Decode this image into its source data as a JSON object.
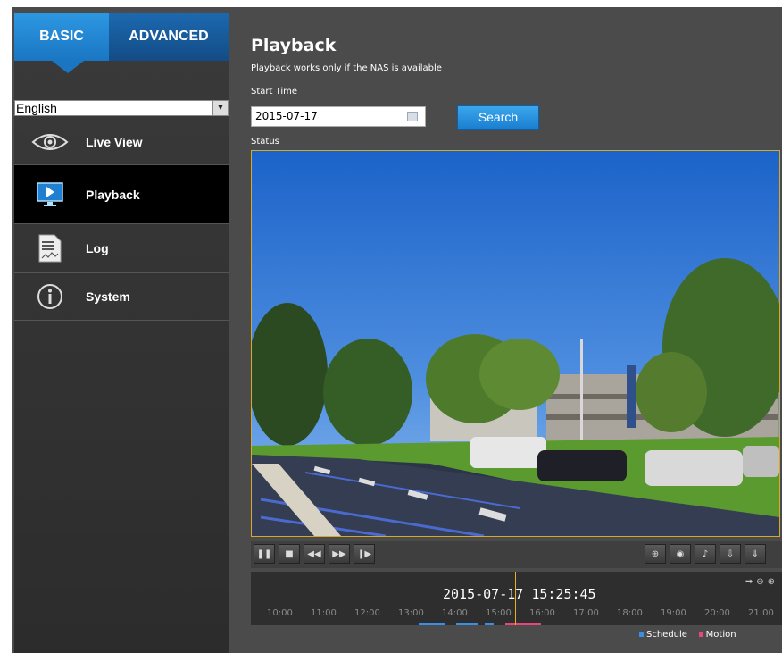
{
  "tabs": {
    "basic": "BASIC",
    "advanced": "ADVANCED"
  },
  "language": {
    "selected": "English"
  },
  "nav": {
    "live_view": "Live View",
    "playback": "Playback",
    "log": "Log",
    "system": "System"
  },
  "page": {
    "title": "Playback",
    "subtitle": "Playback works only if the NAS is available",
    "start_time_label": "Start Time",
    "date_value": "2015-07-17",
    "search_label": "Search",
    "status_label": "Status"
  },
  "timeline": {
    "datetime": "2015-07-17 15:25:45",
    "hours": [
      "10:00",
      "11:00",
      "12:00",
      "13:00",
      "14:00",
      "15:00",
      "16:00",
      "17:00",
      "18:00",
      "19:00",
      "20:00",
      "21:00"
    ]
  },
  "legend": {
    "schedule": "Schedule",
    "motion": "Motion"
  },
  "colors": {
    "accent": "#1a76c3",
    "schedule": "#3b8ee8",
    "motion": "#e8457a",
    "cursor": "#e8b020"
  }
}
